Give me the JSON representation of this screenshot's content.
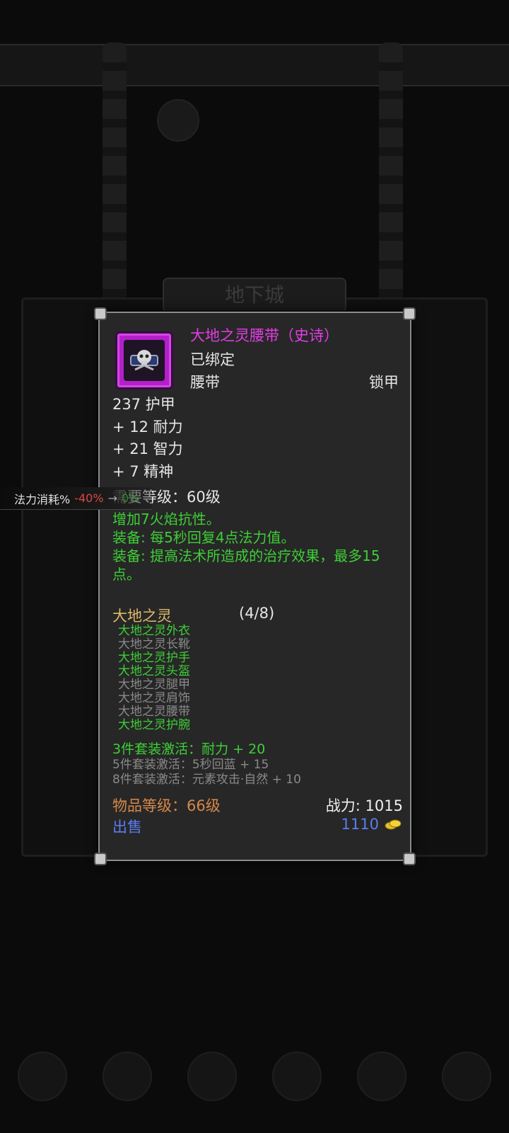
{
  "tooltip": {
    "item_name": "大地之灵腰带（史诗）",
    "bound": "已绑定",
    "slot": "腰带",
    "armor_type": "锁甲",
    "stats": [
      "237 护甲",
      "+ 12 耐力",
      "+ 21 智力",
      "+ 7 精神"
    ],
    "required_level": "需要等级：60级",
    "effects": [
      "增加7火焰抗性。",
      "装备: 每5秒回复4点法力值。",
      "装备: 提高法术所造成的治疗效果，最多15点。"
    ],
    "set": {
      "name": "大地之灵",
      "count": "(4/8)",
      "pieces": [
        {
          "name": "大地之灵外衣",
          "active": true
        },
        {
          "name": "大地之灵长靴",
          "active": false
        },
        {
          "name": "大地之灵护手",
          "active": true
        },
        {
          "name": "大地之灵头盔",
          "active": true
        },
        {
          "name": "大地之灵腿甲",
          "active": false
        },
        {
          "name": "大地之灵肩饰",
          "active": false
        },
        {
          "name": "大地之灵腰带",
          "active": false
        },
        {
          "name": "大地之灵护腕",
          "active": true
        }
      ],
      "bonuses": [
        {
          "text": "3件套装激活：耐力 + 20",
          "active": true
        },
        {
          "text": "5件套装激活：5秒回蓝 + 15",
          "active": false
        },
        {
          "text": "8件套装激活：元素攻击·自然 + 10",
          "active": false
        }
      ]
    },
    "item_level": "物品等级：66级",
    "power": "战力: 1015",
    "sell_label": "出售",
    "price": "1110",
    "rarity_color": "#e33ee6",
    "icon_name": "belt-item-icon",
    "currency_icon": "gold-coin-icon"
  },
  "float_label": {
    "label": "法力消耗%",
    "value": "-40%",
    "arrow": "→",
    "result": "0%"
  },
  "background": {
    "dungeon_title": "地下城"
  }
}
